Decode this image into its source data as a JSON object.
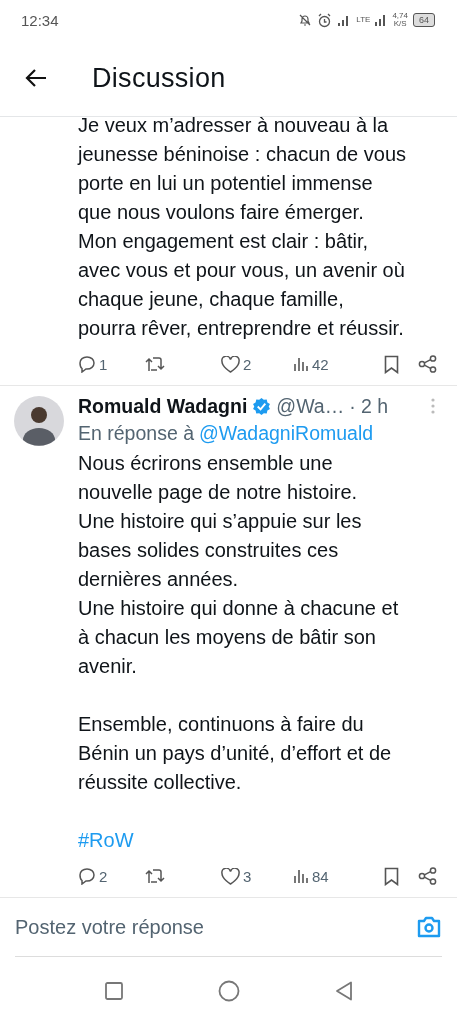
{
  "status_bar": {
    "time": "12:34",
    "network": "LTE",
    "speed": "4,74",
    "speed_unit": "K/S",
    "battery": "64"
  },
  "header": {
    "title": "Discussion"
  },
  "tweets": [
    {
      "kind": "continued",
      "text": [
        "Je veux m’adresser à nouveau à la\njeunesse béninoise : chacun de vous\nporte en lui un potentiel immense\nque nous voulons faire émerger.\nMon engagement est clair : bâtir,\navec vous et pour vous, un avenir où\nchaque jeune, chaque famille,\npourra rêver, entreprendre et réussir."
      ],
      "replies": "1",
      "likes": "2",
      "views": "42"
    },
    {
      "kind": "full",
      "author": "Romuald Wadagni",
      "verified": true,
      "handle": "@Wa…",
      "time": "· 2 h",
      "reply_prefix": "En réponse à",
      "reply_to": "@WadagniRomuald",
      "text": [
        "Nous écrirons ensemble une\nnouvelle page de notre histoire.\nUne histoire qui s’appuie sur les\nbases solides construites ces\ndernières années.\nUne histoire qui donne à chacune et\nà chacun les moyens de bâtir son\navenir.",
        "Ensemble, continuons à faire du\nBénin un pays d’unité, d’effort et de\nréussite collective."
      ],
      "hashtag": "#RoW",
      "replies": "2",
      "likes": "3",
      "views": "84"
    }
  ],
  "reply_field": {
    "placeholder": "Postez votre réponse"
  }
}
